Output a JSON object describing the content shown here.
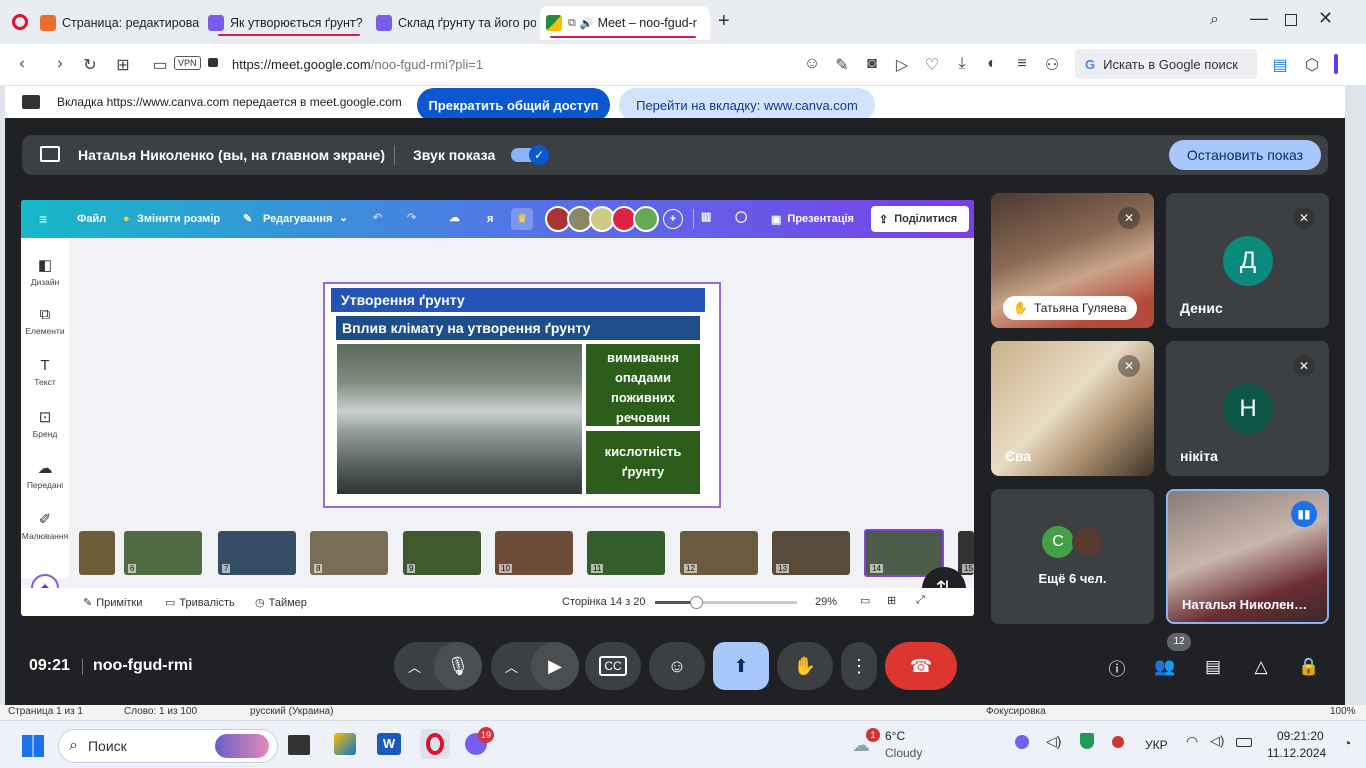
{
  "tabs": [
    {
      "title": "Страница: редактирован",
      "color": "#e8462f",
      "active": false
    },
    {
      "title": "Як утворюється ґрунт? –",
      "color": "#7a5ce6",
      "active": false
    },
    {
      "title": "Склад ґрунту та його род",
      "color": "#7a5ce6",
      "active": false
    },
    {
      "title": "Meet – noo-fgud-r",
      "color": "#1e8e3e",
      "active": true
    }
  ],
  "browser": {
    "url_host": "https://meet.google.com",
    "url_path": "/noo-fgud-rmi?pli=1",
    "vpn": "VPN",
    "search": "Искать в Google поиск"
  },
  "share_banner": {
    "text": "Вкладка https://www.canva.com передается в meet.google.com",
    "stop": "Прекратить общий доступ",
    "goto": "Перейти на вкладку: www.canva.com"
  },
  "presenting": {
    "label": "Наталья Николенко (вы, на главном экране)",
    "sound": "Звук показа",
    "stop": "Остановить показ"
  },
  "canva": {
    "menu": {
      "file": "Файл",
      "resize": "Змінити розмір",
      "edit": "Редагування",
      "letter": "я",
      "present": "Презентація",
      "share": "Поділитися"
    },
    "sidebar": [
      "Дизайн",
      "Елементи",
      "Текст",
      "Бренд",
      "Передані",
      "Малювання"
    ],
    "slide": {
      "title": "Утворення ґрунту",
      "subtitle": "Вплив клімату на утворення ґрунту",
      "box1": "вимивання опадами поживних речовин",
      "box2": "кислотність ґрунту"
    },
    "thumbs": [
      "6",
      "7",
      "8",
      "9",
      "10",
      "11",
      "12",
      "13",
      "14",
      "15"
    ],
    "bottom": {
      "notes": "Примітки",
      "duration": "Тривалість",
      "timer": "Таймер",
      "page": "Сторінка 14 з 20",
      "zoom": "29%",
      "zoom_level": 0.29
    }
  },
  "participants": [
    {
      "name": "Татьяна Гуляева",
      "type": "video"
    },
    {
      "name": "Денис",
      "initial": "Д",
      "color": "#0b8a7e"
    },
    {
      "name": "Єва",
      "type": "video"
    },
    {
      "name": "нікіта",
      "initial": "Н",
      "color": "#0d5749"
    },
    {
      "name": "Ещё 6 чел.",
      "initial": "С",
      "color": "#43a047"
    },
    {
      "name": "Наталья Николен…",
      "type": "video"
    }
  ],
  "controls": {
    "time": "09:21",
    "code": "noo-fgud-rmi",
    "people_count": "12"
  },
  "taskbar": {
    "search": "Поиск",
    "weather_temp": "6°C",
    "weather_desc": "Cloudy",
    "weather_badge": "1",
    "viber_badge": "19",
    "lang": "УКР",
    "clock_time": "09:21:20",
    "clock_date": "11.12.2024",
    "behind": [
      "Страница 1 из 1",
      "Слово: 1 из 100",
      "русский (Украина)",
      "Фокусировка",
      "100%"
    ]
  }
}
